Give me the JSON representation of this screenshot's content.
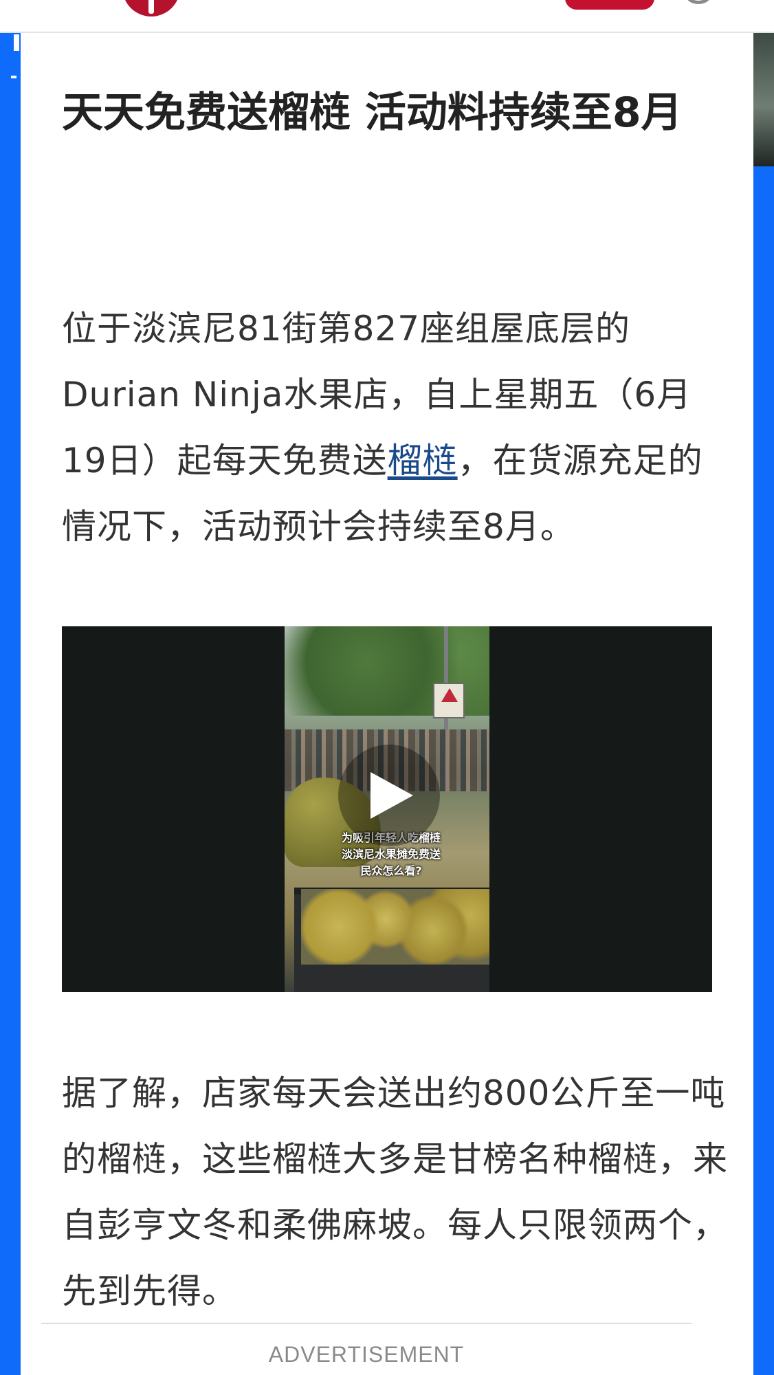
{
  "article": {
    "headline": "天天免费送榴梿 活动料持续至8月",
    "paragraph_1": {
      "before_link": "位于淡滨尼81街第827座组屋底层的Durian Ninja水果店，自上星期五（6月19日）起每天免费送",
      "link_text": "榴梿",
      "after_link": "，在货源充足的情况下，活动预计会持续至8月。"
    },
    "video": {
      "caption_overlay": "为吸引年轻人吃榴梿\n淡滨尼水果摊免费送\n民众怎么看?"
    },
    "paragraph_2": "据了解，店家每天会送出约800公斤至一吨的榴梿，这些榴梿大多是甘榜名种榴梿，来自彭亨文冬和柔佛麻坡。每人只限领两个，先到先得。"
  },
  "advertisement": {
    "label": "ADVERTISEMENT"
  },
  "colors": {
    "brand_red": "#b5122e",
    "side_background": "#0f6bfa",
    "link": "#1a4a8a",
    "headline_text": "#222222",
    "body_text": "#333333"
  },
  "icons": {
    "logo": "brand-logo-icon",
    "user": "user-icon",
    "play": "play-icon"
  }
}
